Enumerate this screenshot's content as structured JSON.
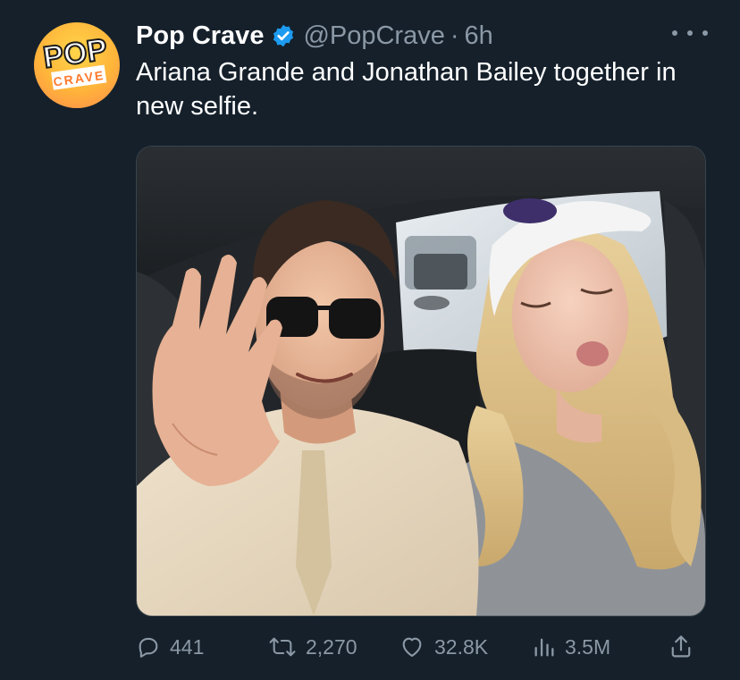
{
  "tweet": {
    "display_name": "Pop Crave",
    "handle": "@PopCrave",
    "separator": "·",
    "time": "6h",
    "text": "Ariana Grande and Jonathan Bailey together in new selfie.",
    "avatar": {
      "logo_top": "POP",
      "logo_bottom": "CRAVE"
    },
    "verified_color": "#1d9bf0"
  },
  "actions": {
    "replies": "441",
    "reposts": "2,270",
    "likes": "32.8K",
    "views": "3.5M"
  },
  "colors": {
    "background": "#15202b",
    "secondary_text": "#8b98a5",
    "primary_text": "#ffffff"
  }
}
